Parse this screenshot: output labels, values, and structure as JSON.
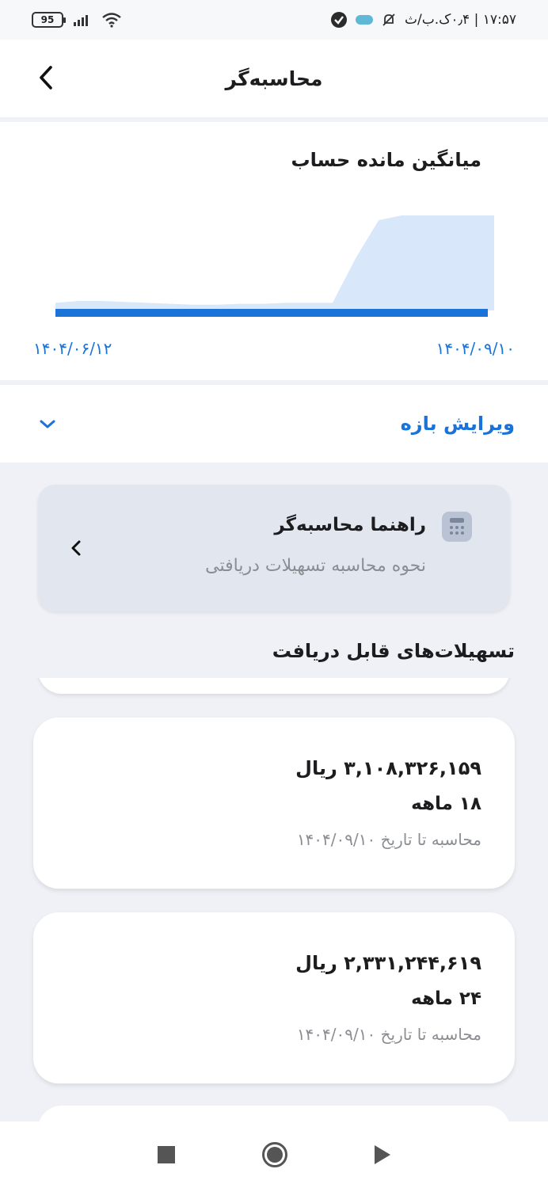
{
  "status_bar": {
    "battery": "95",
    "time_text": "۱۷:۵۷ | ۰٫۴ک.ب/ث"
  },
  "header": {
    "title": "محاسبه‌گر"
  },
  "chart": {
    "title": "میانگین مانده حساب",
    "start_date": "۱۴۰۴/۰۶/۱۲",
    "end_date": "۱۴۰۴/۰۹/۱۰"
  },
  "chart_data": {
    "type": "area",
    "title": "میانگین مانده حساب",
    "x_range": [
      "۱۴۰۴/۰۶/۱۲",
      "۱۴۰۴/۰۹/۱۰"
    ],
    "series": [
      {
        "values": [
          0.08,
          0.1,
          0.1,
          0.09,
          0.08,
          0.07,
          0.06,
          0.06,
          0.07,
          0.07,
          0.08,
          0.08,
          0.08,
          0.55,
          0.95,
          1.0,
          1.0,
          1.0,
          1.0,
          1.0
        ]
      }
    ],
    "baseline_color": "#1a73d9",
    "fill_color": "#d8e8fa",
    "grid": false
  },
  "range": {
    "label": "ویرایش بازه"
  },
  "guide": {
    "title": "راهنما محاسبه‌گر",
    "subtitle": "نحوه محاسبه تسهیلات دریافتی"
  },
  "loans_section": {
    "title": "تسهیلات‌های قابل دریافت"
  },
  "loans": [
    {
      "amount": "۳,۱۰۸,۳۲۶,۱۵۹ ریال",
      "term": "۱۸ ماهه",
      "date_note": "محاسبه تا تاریخ ۱۴۰۴/۰۹/۱۰"
    },
    {
      "amount": "۲,۳۳۱,۲۴۴,۶۱۹ ریال",
      "term": "۲۴ ماهه",
      "date_note": "محاسبه تا تاریخ ۱۴۰۴/۰۹/۱۰"
    }
  ],
  "colors": {
    "accent": "#1a73d9",
    "background": "#eff1f6",
    "card": "#ffffff"
  }
}
